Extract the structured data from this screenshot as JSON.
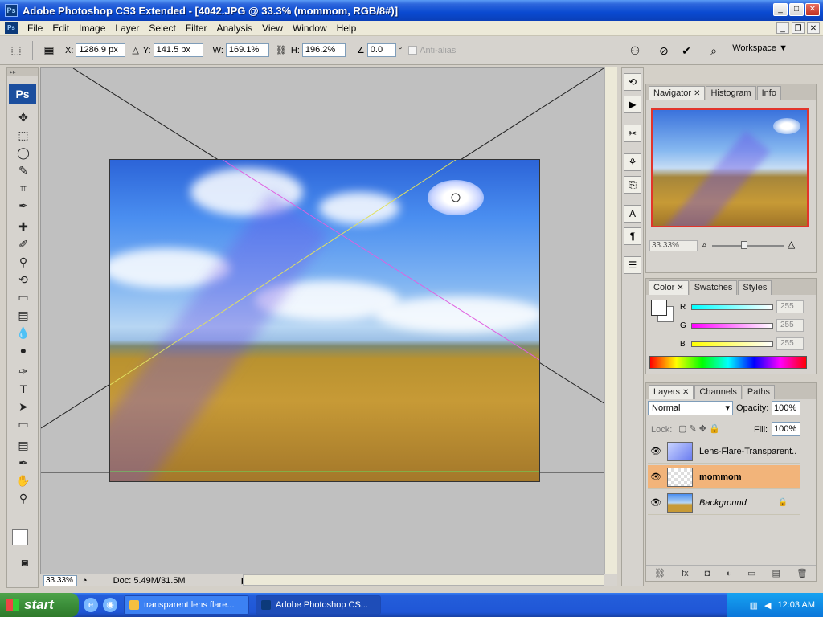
{
  "window": {
    "title": "Adobe Photoshop CS3 Extended - [4042.JPG @ 33.3% (mommom, RGB/8#)]",
    "app_icon": "Ps",
    "min": "_",
    "max": "□",
    "close": "✕"
  },
  "menu": {
    "items": [
      "File",
      "Edit",
      "Image",
      "Layer",
      "Select",
      "Filter",
      "Analysis",
      "View",
      "Window",
      "Help"
    ],
    "doc_icon": "Ps"
  },
  "options": {
    "x_label": "X:",
    "x_value": "1286.9 px",
    "y_label": "Y:",
    "y_value": "141.5 px",
    "w_label": "W:",
    "w_value": "169.1%",
    "h_label": "H:",
    "h_value": "196.2%",
    "angle_value": "0.0",
    "degree": "°",
    "antialias_label": "Anti-alias",
    "workspace_label": "Workspace ▼"
  },
  "toolbox": {
    "logo": "Ps"
  },
  "status": {
    "zoom": "33.33%",
    "doc": "Doc: 5.49M/31.5M"
  },
  "navigator_panel": {
    "tabs": [
      {
        "label": "Navigator",
        "x": "✕"
      },
      {
        "label": "Histogram"
      },
      {
        "label": "Info"
      }
    ],
    "zoom": "33.33%"
  },
  "color_panel": {
    "tabs": [
      {
        "label": "Color",
        "x": "✕"
      },
      {
        "label": "Swatches"
      },
      {
        "label": "Styles"
      }
    ],
    "r_label": "R",
    "r_value": "255",
    "g_label": "G",
    "g_value": "255",
    "b_label": "B",
    "b_value": "255"
  },
  "layers_panel": {
    "tabs": [
      {
        "label": "Layers",
        "x": "✕"
      },
      {
        "label": "Channels"
      },
      {
        "label": "Paths"
      }
    ],
    "blend_mode": "Normal",
    "opacity_label": "Opacity:",
    "opacity_value": "100%",
    "lock_label": "Lock:",
    "fill_label": "Fill:",
    "fill_value": "100%",
    "layers": [
      {
        "name": "Lens-Flare-Transparent..."
      },
      {
        "name": "mommom"
      },
      {
        "name": "Background"
      }
    ]
  },
  "taskbar": {
    "start": "start",
    "items": [
      {
        "label": "transparent lens flare..."
      },
      {
        "label": "Adobe Photoshop CS..."
      }
    ],
    "clock": "12:03 AM"
  },
  "colors": {
    "selected_layer": "#f2b47a",
    "title_blue": "#0a4ad1",
    "nav_frame": "#e2342b"
  }
}
